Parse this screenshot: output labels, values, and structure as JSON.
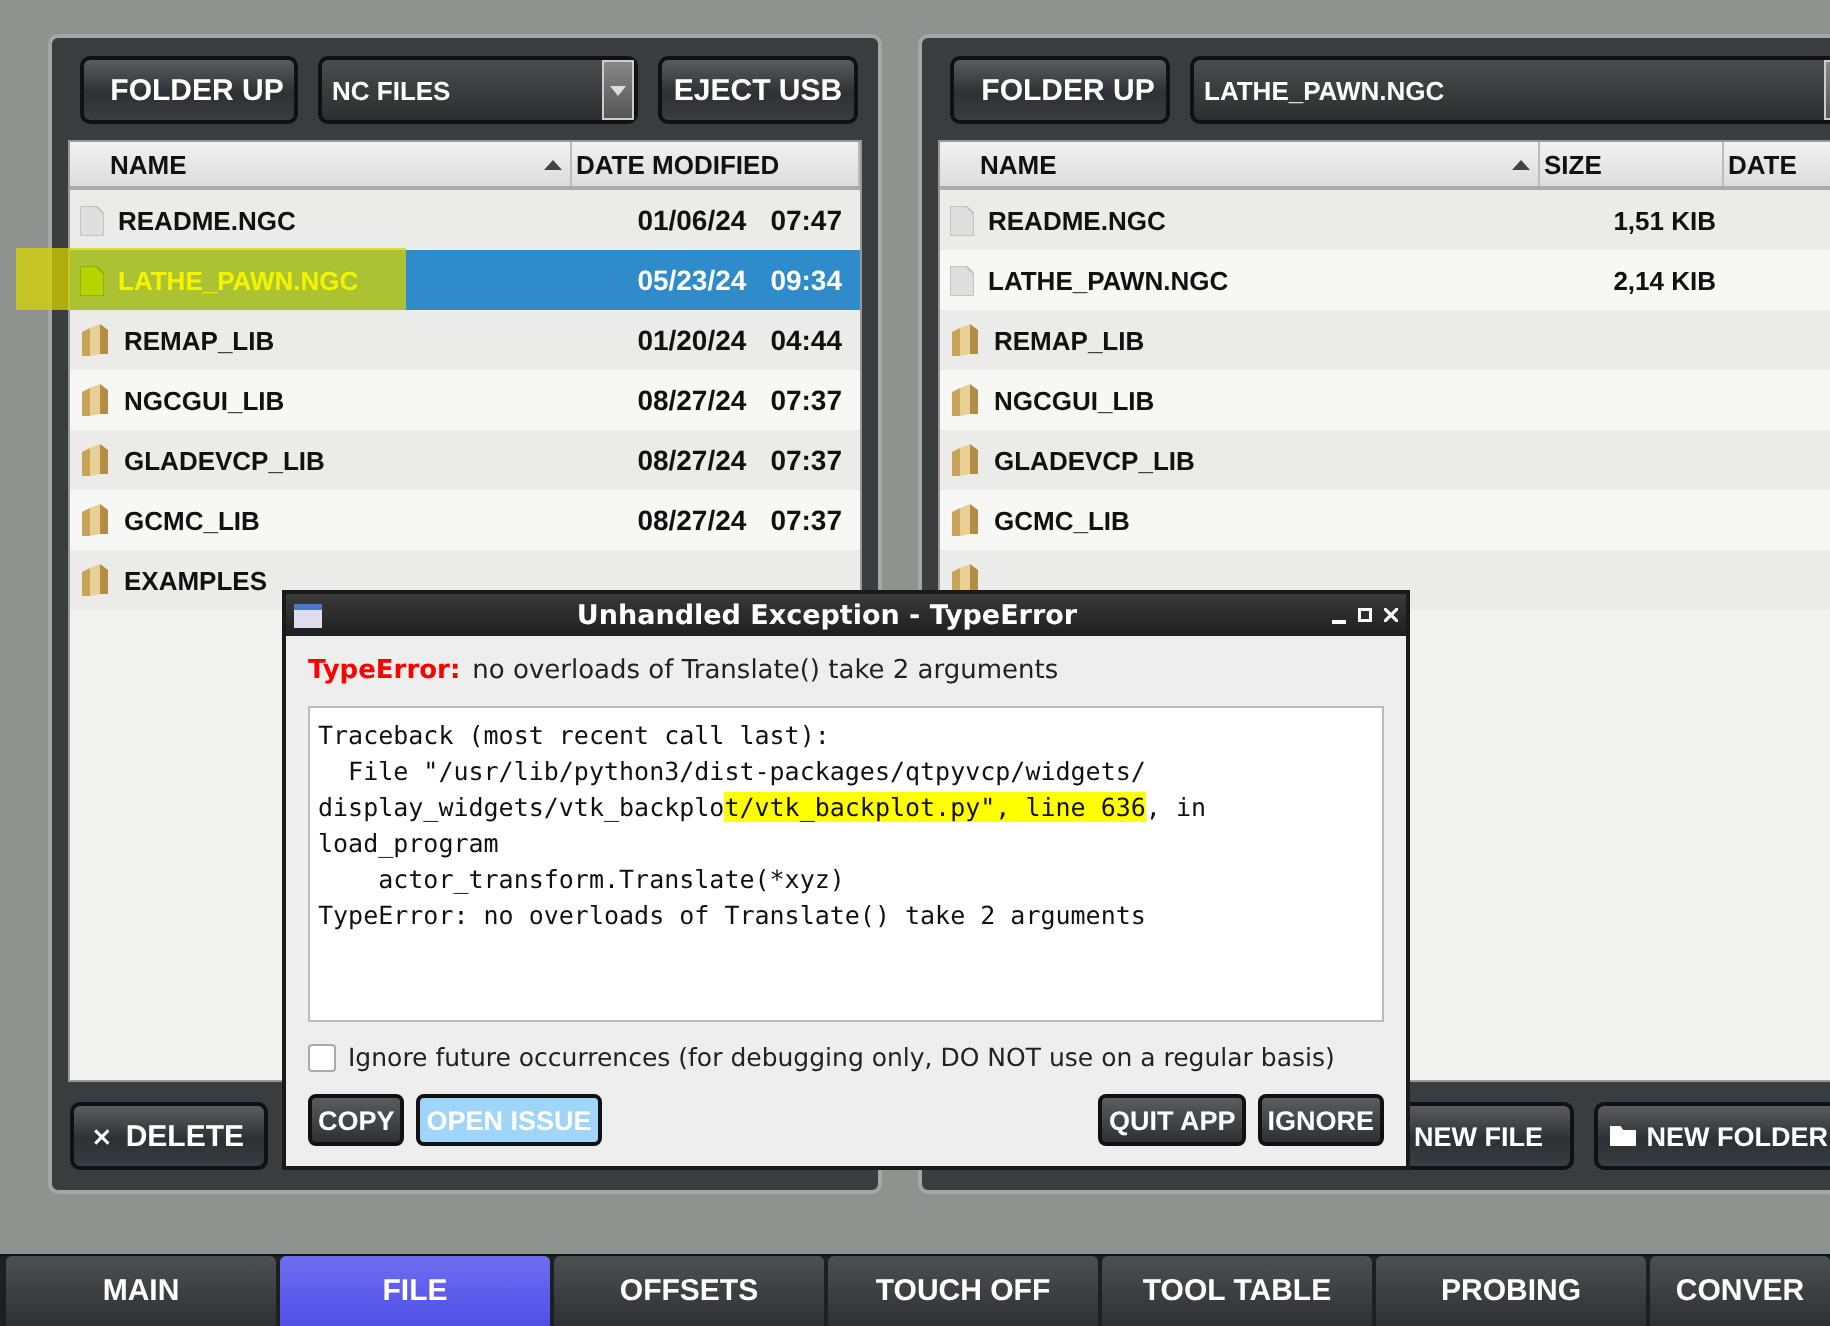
{
  "left_pane": {
    "folder_up": "FOLDER UP",
    "location": "NC FILES",
    "eject": "EJECT USB",
    "columns": [
      {
        "label": "NAME",
        "sorted": true
      },
      {
        "label": "DATE MODIFIED",
        "sorted": false
      }
    ],
    "rows": [
      {
        "name": "README.NGC",
        "kind": "file",
        "date": "01/06/24",
        "time": "07:47",
        "selected": false,
        "highlighted": false
      },
      {
        "name": "LATHE_PAWN.NGC",
        "kind": "file",
        "date": "05/23/24",
        "time": "09:34",
        "selected": true,
        "highlighted": true
      },
      {
        "name": "REMAP_LIB",
        "kind": "folder",
        "date": "01/20/24",
        "time": "04:44",
        "selected": false,
        "highlighted": false
      },
      {
        "name": "NGCGUI_LIB",
        "kind": "folder",
        "date": "08/27/24",
        "time": "07:37",
        "selected": false,
        "highlighted": false
      },
      {
        "name": "GLADEVCP_LIB",
        "kind": "folder",
        "date": "08/27/24",
        "time": "07:37",
        "selected": false,
        "highlighted": false
      },
      {
        "name": "GCMC_LIB",
        "kind": "folder",
        "date": "08/27/24",
        "time": "07:37",
        "selected": false,
        "highlighted": false
      },
      {
        "name": "EXAMPLES",
        "kind": "folder",
        "selected": false,
        "highlighted": false
      }
    ],
    "delete": "DELETE"
  },
  "right_pane": {
    "folder_up": "FOLDER UP",
    "location": "LATHE_PAWN.NGC",
    "columns": [
      {
        "label": "NAME",
        "sorted": true
      },
      {
        "label": "SIZE",
        "sorted": false
      },
      {
        "label": "DATE",
        "sorted": false
      }
    ],
    "rows": [
      {
        "name": "README.NGC",
        "kind": "file",
        "size": "1,51 KIB"
      },
      {
        "name": "LATHE_PAWN.NGC",
        "kind": "file",
        "size": "2,14 KIB"
      },
      {
        "name": "REMAP_LIB",
        "kind": "folder"
      },
      {
        "name": "NGCGUI_LIB",
        "kind": "folder"
      },
      {
        "name": "GLADEVCP_LIB",
        "kind": "folder"
      },
      {
        "name": "GCMC_LIB",
        "kind": "folder"
      },
      {
        "kind": "folder"
      }
    ],
    "new_file": "NEW FILE",
    "new_folder": "NEW FOLDER"
  },
  "dialog": {
    "title": "Unhandled Exception - TypeError",
    "error_type": "TypeError:",
    "error_message": "no overloads of Translate() take 2 arguments",
    "traceback": [
      [
        {
          "text": "Traceback (most recent call last):",
          "highlighted": false
        }
      ],
      [
        {
          "text": "  File \"/usr/lib/python3/dist-packages/qtpyvcp/widgets/",
          "highlighted": false
        }
      ],
      [
        {
          "text": "display_widgets/vtk_backplo",
          "highlighted": false
        },
        {
          "text": "t/vtk_backplot.py\", line 636",
          "highlighted": true
        },
        {
          "text": ", in",
          "highlighted": false
        }
      ],
      [
        {
          "text": "load_program",
          "highlighted": false
        }
      ],
      [
        {
          "text": "    actor_transform.Translate(*xyz)",
          "highlighted": false
        }
      ],
      [
        {
          "text": "TypeError: no overloads of Translate() take 2 arguments",
          "highlighted": false
        }
      ]
    ],
    "ignore_future": {
      "label": "Ignore future occurrences (for debugging only, DO NOT use on a regular basis)",
      "checked": false
    },
    "left_buttons": [
      {
        "label": "COPY",
        "focused": false
      },
      {
        "label": "OPEN ISSUE",
        "focused": true
      }
    ],
    "right_buttons": [
      {
        "label": "QUIT APP",
        "focused": false
      },
      {
        "label": "IGNORE",
        "focused": false
      }
    ]
  },
  "tabs": [
    {
      "label": "MAIN",
      "selected": false
    },
    {
      "label": "FILE",
      "selected": true
    },
    {
      "label": "OFFSETS",
      "selected": false
    },
    {
      "label": "TOUCH OFF",
      "selected": false
    },
    {
      "label": "TOOL TABLE",
      "selected": false
    },
    {
      "label": "PROBING",
      "selected": false
    },
    {
      "label": "CONVER",
      "selected": false
    }
  ]
}
